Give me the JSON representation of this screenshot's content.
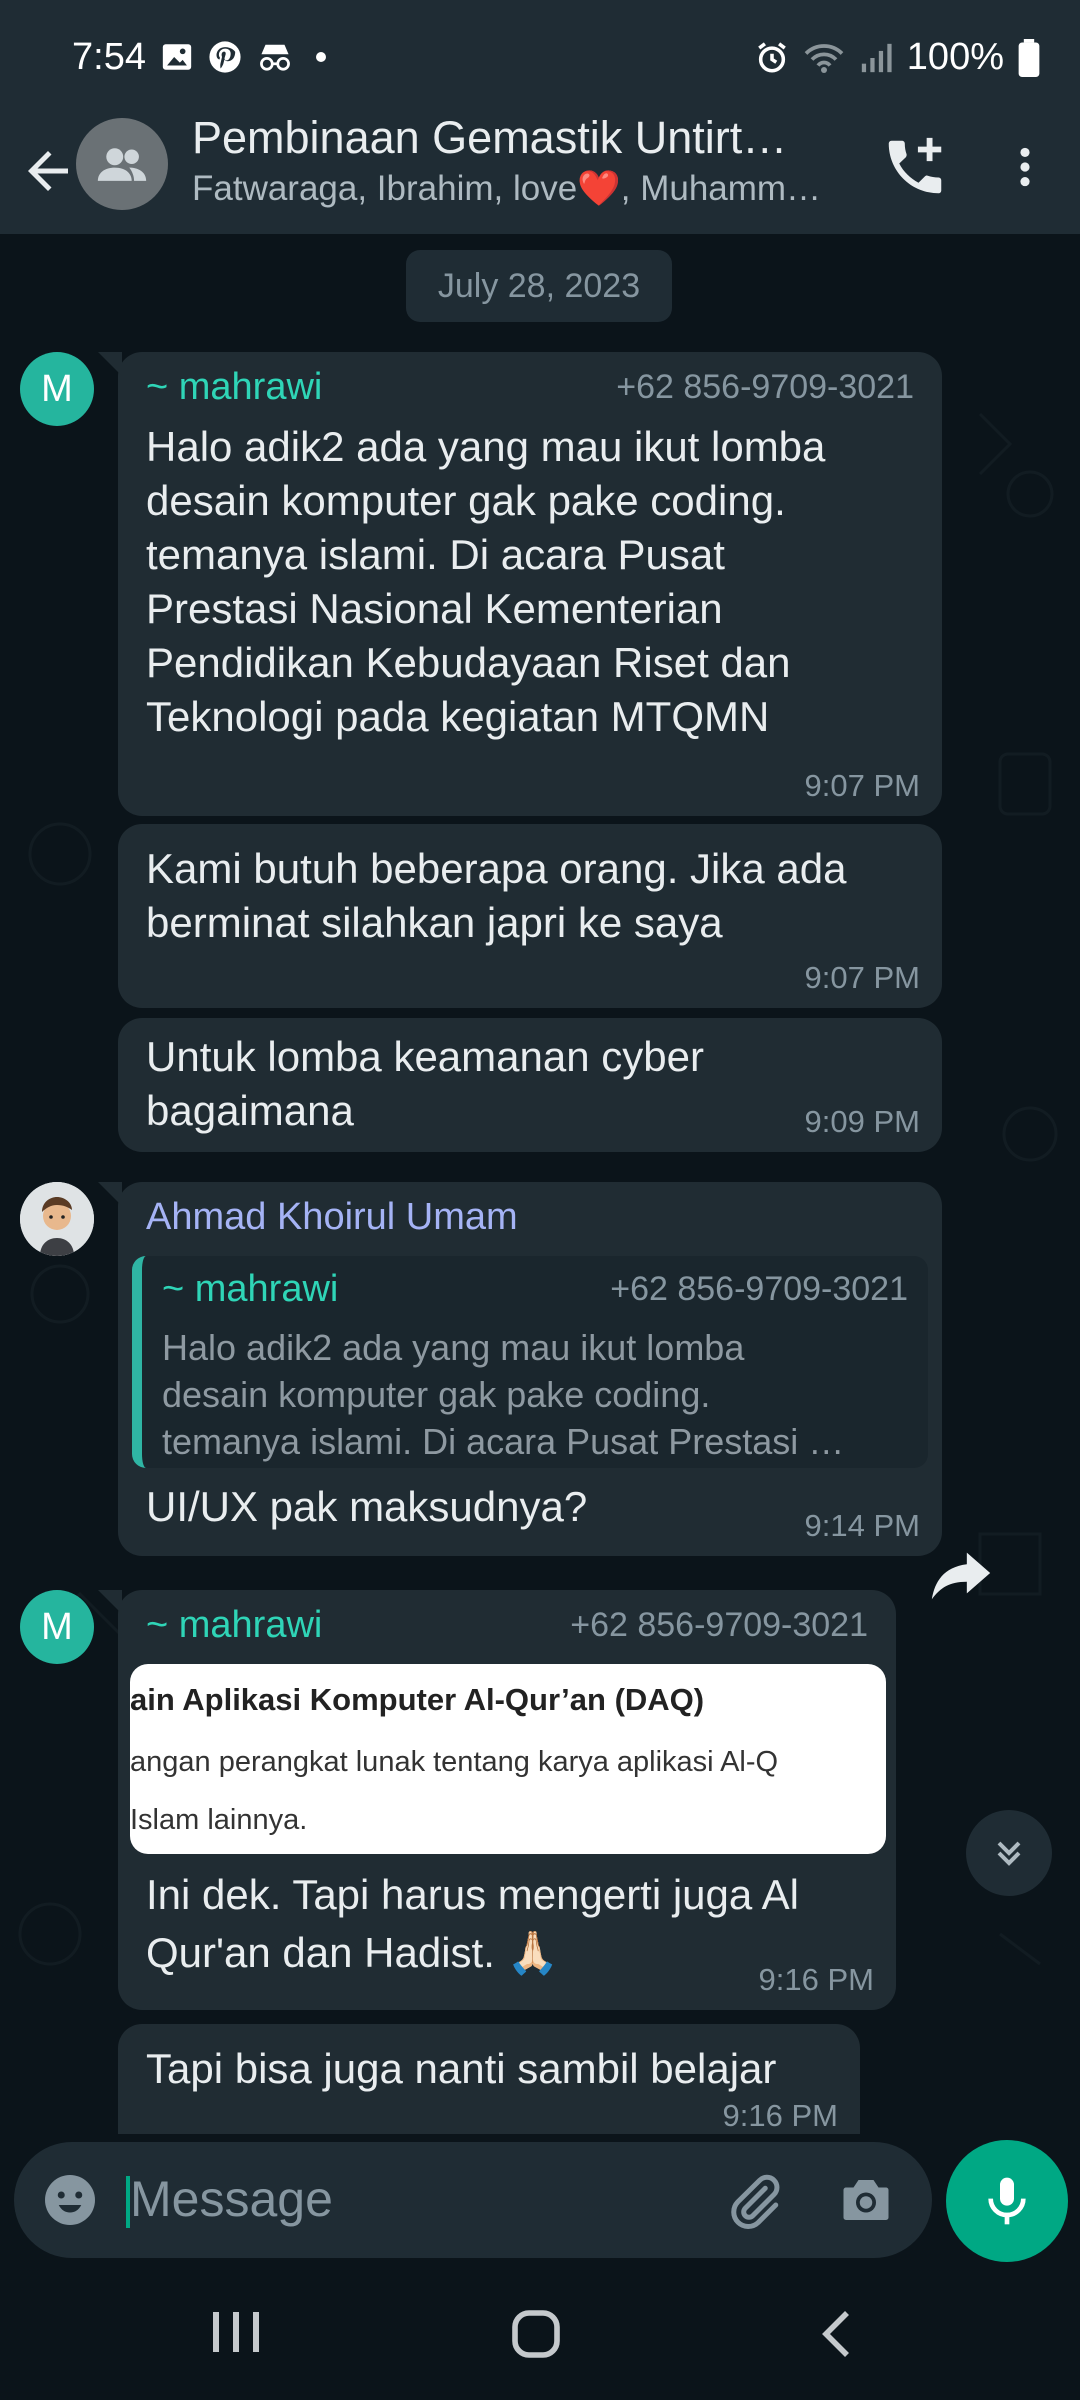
{
  "status_bar": {
    "time": "7:54",
    "battery": "100%"
  },
  "header": {
    "title": "Pembinaan Gemastik Untirt…",
    "subtitle": "Fatwaraga, Ibrahim, love❤️, Muhamm…"
  },
  "chat": {
    "date_chip": "July 28, 2023",
    "messages": [
      {
        "avatar_letter": "M",
        "sender": "~ mahrawi",
        "phone": "+62 856-9709-3021",
        "lines": [
          "Halo adik2 ada yang mau ikut lomba",
          "desain komputer gak pake coding.",
          "temanya islami. Di acara Pusat",
          "Prestasi Nasional Kementerian",
          "Pendidikan Kebudayaan Riset dan",
          "Teknologi pada kegiatan MTQMN"
        ],
        "time": "9:07 PM"
      },
      {
        "lines": [
          "Kami butuh beberapa orang. Jika ada",
          "berminat silahkan japri ke saya"
        ],
        "time": "9:07 PM"
      },
      {
        "lines": [
          "Untuk lomba keamanan cyber",
          "bagaimana"
        ],
        "time": "9:09 PM"
      },
      {
        "sender": "Ahmad Khoirul Umam",
        "quote": {
          "sender": "~ mahrawi",
          "phone": "+62 856-9709-3021",
          "lines": [
            "Halo adik2 ada yang mau ikut lomba",
            "desain komputer gak pake coding.",
            "temanya islami. Di acara Pusat Prestasi …"
          ]
        },
        "text": "UI/UX pak maksudnya?",
        "time": "9:14 PM"
      },
      {
        "avatar_letter": "M",
        "sender": "~ mahrawi",
        "phone": "+62 856-9709-3021",
        "image_lines": [
          "ain Aplikasi Komputer Al-Qur’an (DAQ)",
          "angan perangkat lunak tentang karya aplikasi Al-Q",
          "Islam lainnya."
        ],
        "lines": [
          "Ini dek. Tapi harus mengerti juga Al",
          "Qur'an dan Hadist. 🙏🏻"
        ],
        "time": "9:16 PM"
      },
      {
        "lines": [
          "Tapi bisa juga nanti sambil belajar"
        ],
        "time": "9:16 PM"
      }
    ]
  },
  "composer": {
    "placeholder": "Message"
  },
  "colors": {
    "accent": "#00a884",
    "sender_green": "#2fd5b7",
    "sender_purple": "#a5b3f5",
    "bubble": "#202c33",
    "header": "#1f2c34"
  },
  "icons": [
    "gallery-icon",
    "pinterest-icon",
    "incognito-icon",
    "alarm-icon",
    "wifi-icon",
    "signal-icon",
    "battery-icon",
    "back-arrow-icon",
    "group-avatar-icon",
    "add-call-icon",
    "more-vert-icon",
    "forward-icon",
    "scroll-down-icon",
    "emoji-icon",
    "attach-icon",
    "camera-icon",
    "mic-icon"
  ]
}
